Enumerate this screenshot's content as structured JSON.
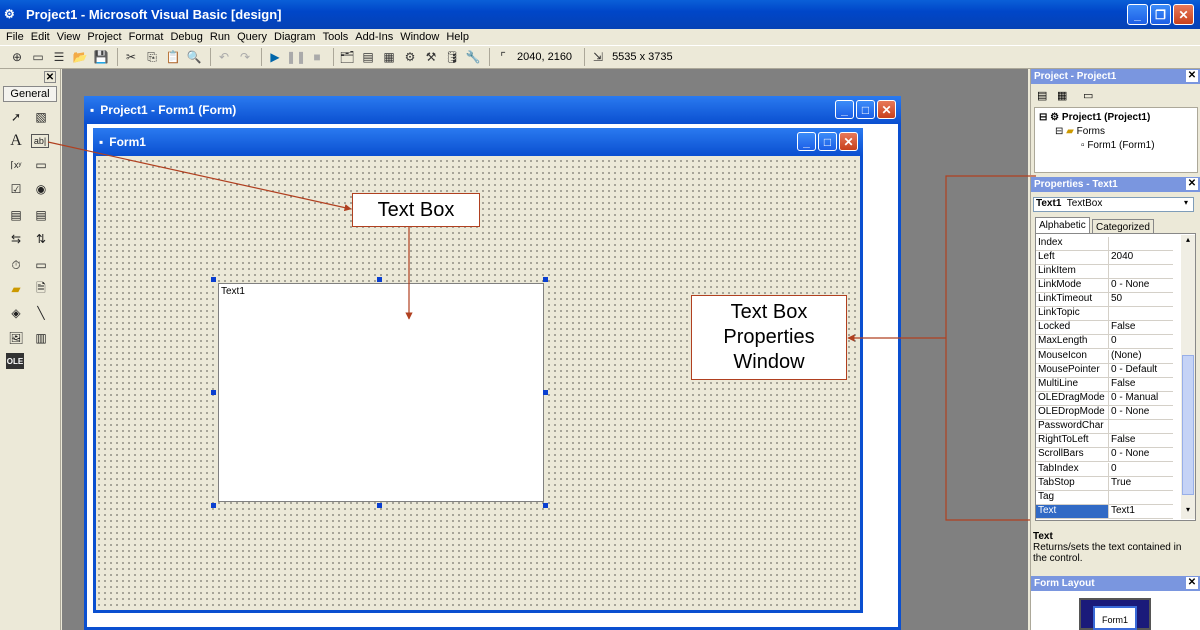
{
  "window": {
    "title": "Project1 - Microsoft Visual Basic [design]"
  },
  "menu": [
    "File",
    "Edit",
    "View",
    "Project",
    "Format",
    "Debug",
    "Run",
    "Query",
    "Diagram",
    "Tools",
    "Add-Ins",
    "Window",
    "Help"
  ],
  "toolbar": {
    "position": "2040, 2160",
    "size": "5535 x 3735"
  },
  "toolbox": {
    "tab_label": "General"
  },
  "form_designer": {
    "title": "Project1 - Form1 (Form)"
  },
  "form": {
    "title": "Form1"
  },
  "textbox": {
    "text": "Text1"
  },
  "callouts": {
    "textbox": "Text Box",
    "properties_line1": "Text Box",
    "properties_line2": "Properties",
    "properties_line3": "Window"
  },
  "project_panel": {
    "title": "Project - Project1",
    "root": "Project1 (Project1)",
    "folder": "Forms",
    "item": "Form1 (Form1)"
  },
  "properties_panel": {
    "title": "Properties - Text1",
    "object_name": "Text1",
    "object_type": "TextBox",
    "tabs": [
      "Alphabetic",
      "Categorized"
    ],
    "rows": [
      {
        "name": "Index",
        "value": ""
      },
      {
        "name": "Left",
        "value": "2040"
      },
      {
        "name": "LinkItem",
        "value": ""
      },
      {
        "name": "LinkMode",
        "value": "0 - None"
      },
      {
        "name": "LinkTimeout",
        "value": "50"
      },
      {
        "name": "LinkTopic",
        "value": ""
      },
      {
        "name": "Locked",
        "value": "False"
      },
      {
        "name": "MaxLength",
        "value": "0"
      },
      {
        "name": "MouseIcon",
        "value": "(None)"
      },
      {
        "name": "MousePointer",
        "value": "0 - Default"
      },
      {
        "name": "MultiLine",
        "value": "False"
      },
      {
        "name": "OLEDragMode",
        "value": "0 - Manual"
      },
      {
        "name": "OLEDropMode",
        "value": "0 - None"
      },
      {
        "name": "PasswordChar",
        "value": ""
      },
      {
        "name": "RightToLeft",
        "value": "False"
      },
      {
        "name": "ScrollBars",
        "value": "0 - None"
      },
      {
        "name": "TabIndex",
        "value": "0"
      },
      {
        "name": "TabStop",
        "value": "True"
      },
      {
        "name": "Tag",
        "value": ""
      },
      {
        "name": "Text",
        "value": "Text1"
      }
    ],
    "description_title": "Text",
    "description_body": "Returns/sets the text contained in the control."
  },
  "form_layout_panel": {
    "title": "Form Layout",
    "preview_label": "Form1"
  },
  "colors": {
    "titlebar": "#0046c8",
    "panel_title": "#7a96df",
    "callout_border": "#b04020",
    "selection": "#316ac5"
  }
}
